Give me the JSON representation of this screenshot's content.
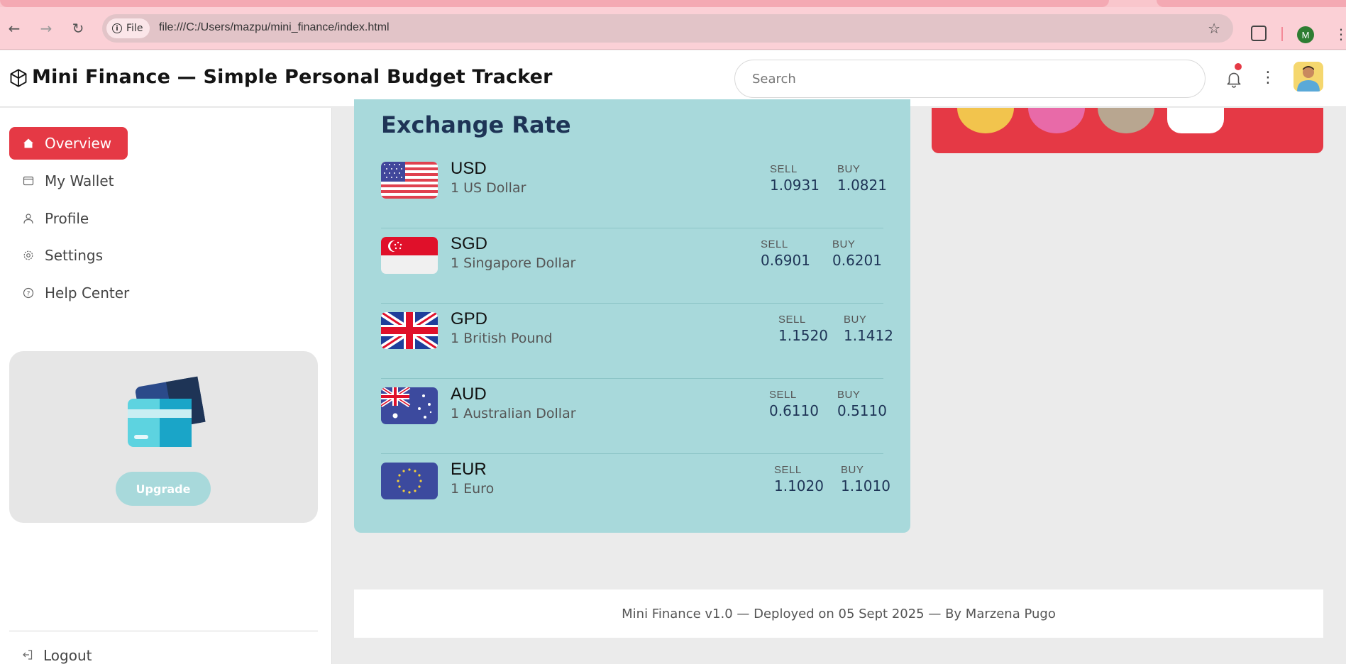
{
  "browser": {
    "site_chip": "File",
    "url": "file:///C:/Users/mazpu/mini_finance/index.html",
    "profile_initial": "M",
    "icons": [
      "back-icon",
      "forward-icon",
      "reload-icon",
      "info-icon",
      "star-icon",
      "extensions-icon",
      "kebab-icon"
    ]
  },
  "header": {
    "title": "Mini Finance — Simple Personal Budget Tracker",
    "search_placeholder": "Search",
    "notification_dot_color": "#e53945"
  },
  "sidebar": {
    "items": [
      {
        "label": "Overview",
        "icon": "home-icon",
        "active": true
      },
      {
        "label": "My Wallet",
        "icon": "wallet-icon",
        "active": false
      },
      {
        "label": "Profile",
        "icon": "user-icon",
        "active": false
      },
      {
        "label": "Settings",
        "icon": "gear-icon",
        "active": false
      },
      {
        "label": "Help Center",
        "icon": "help-icon",
        "active": false
      }
    ],
    "upgrade_label": "Upgrade",
    "logout_label": "Logout"
  },
  "exchange": {
    "title": "Exchange Rate",
    "sell_label": "SELL",
    "buy_label": "BUY",
    "rows": [
      {
        "code": "USD",
        "name": "1 US Dollar",
        "sell": "1.0931",
        "buy": "1.0821",
        "flag": "us-flag-icon"
      },
      {
        "code": "SGD",
        "name": "1 Singapore Dollar",
        "sell": "0.6901",
        "buy": "0.6201",
        "flag": "sg-flag-icon"
      },
      {
        "code": "GPD",
        "name": "1 British Pound",
        "sell": "1.1520",
        "buy": "1.1412",
        "flag": "uk-flag-icon"
      },
      {
        "code": "AUD",
        "name": "1 Australian Dollar",
        "sell": "0.6110",
        "buy": "0.5110",
        "flag": "au-flag-icon"
      },
      {
        "code": "EUR",
        "name": "1 Euro",
        "sell": "1.1020",
        "buy": "1.1010",
        "flag": "eu-flag-icon"
      }
    ]
  },
  "footer": {
    "text": "Mini Finance v1.0 — Deployed on 05 Sept 2025 — By Marzena Pugo"
  },
  "colors": {
    "accent": "#e53945",
    "exchange_bg": "#a8d9db",
    "title_navy": "#1e3456"
  }
}
